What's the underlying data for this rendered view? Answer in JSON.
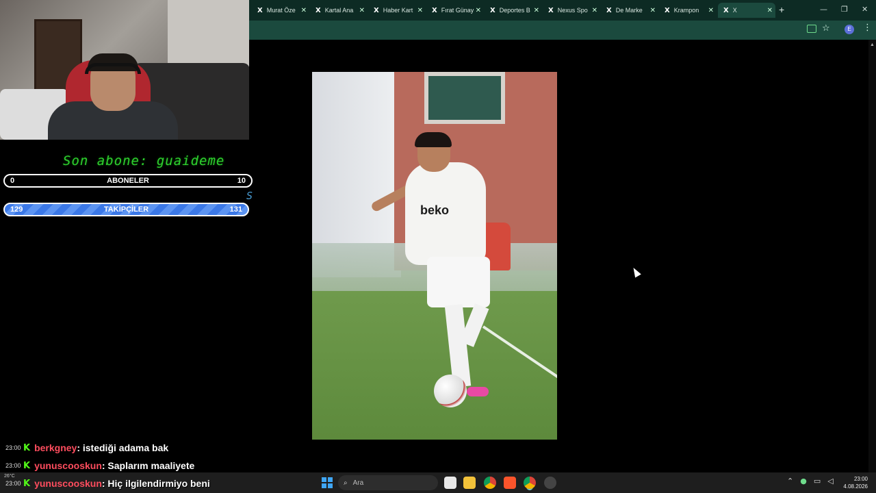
{
  "browser": {
    "tabs": [
      {
        "label": "Murat Öze"
      },
      {
        "label": "Kartal Ana"
      },
      {
        "label": "Haber Kart"
      },
      {
        "label": "Fırat Günay"
      },
      {
        "label": "Deportes B"
      },
      {
        "label": "Nexus Spo"
      },
      {
        "label": "De Marke"
      },
      {
        "label": "Krampon"
      },
      {
        "label": "X"
      }
    ],
    "tab_logo": "X",
    "close_glyph": "✕",
    "new_tab_glyph": "+",
    "window_controls": {
      "minimize": "—",
      "maximize": "❐",
      "close": "✕"
    },
    "star_glyph": "☆",
    "profile_initial": "E",
    "menu_glyph": "⋮"
  },
  "overlay": {
    "sub_ticker": "Son abone: guaideme",
    "sub_ticker_tail": "S",
    "subscribers_goal": {
      "label": "ABONELER",
      "current": "0",
      "target": "10",
      "progress": 0
    },
    "followers_goal": {
      "label": "TAKİPÇİLER",
      "current": "129",
      "target": "131",
      "progress": 0.98
    }
  },
  "photo": {
    "sponsor_text": "beko"
  },
  "chat": [
    {
      "time": "23:00",
      "badge": "K",
      "user": "berkgney",
      "message": ": istediği adama bak"
    },
    {
      "time": "23:00",
      "badge": "K",
      "user": "yunuscooskun",
      "message": ": Saplarım maaliyete"
    },
    {
      "time": "23:00",
      "badge": "K",
      "user": "yunuscooskun",
      "message": ": Hiç ilgilendirmiyo beni"
    }
  ],
  "taskbar": {
    "search_placeholder": "Ara",
    "search_icon": "⌕",
    "weather": "26°C",
    "clock_time": "23:00",
    "clock_date": "4.08.2026",
    "tray_icons": [
      "chevron-up-icon",
      "mic-icon",
      "network-icon",
      "volume-icon"
    ],
    "accent": "#3fa6f5"
  },
  "colors": {
    "tab_strip": "#0d2b24",
    "toolbar": "#1b4a3e",
    "kick_green": "#53fc18",
    "chat_user": "#ff4d5e",
    "follower_bar": "#3b78e7"
  }
}
